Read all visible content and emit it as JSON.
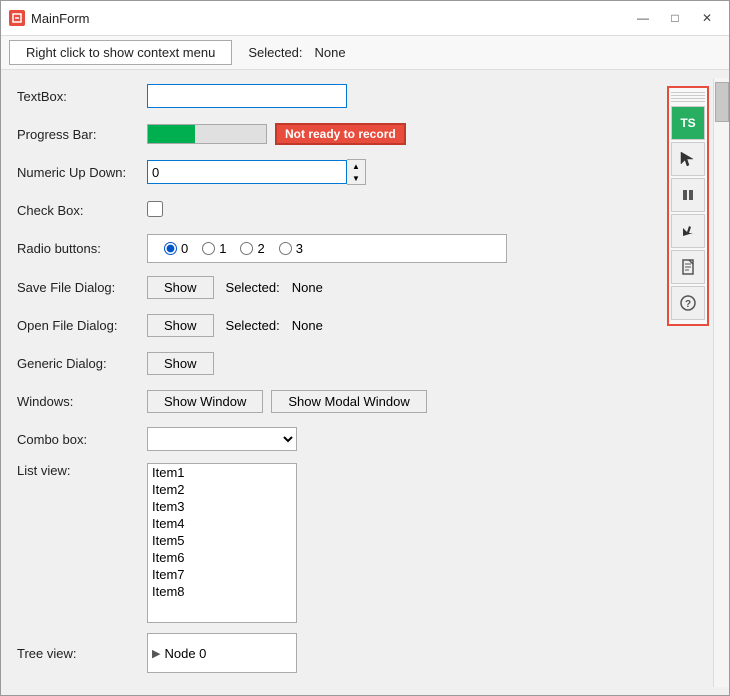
{
  "window": {
    "title": "MainForm",
    "icon": "D"
  },
  "titlebar": {
    "minimize_label": "—",
    "maximize_label": "□",
    "close_label": "✕"
  },
  "toolbar": {
    "context_menu_btn": "Right click to show context menu",
    "selected_label": "Selected:",
    "selected_value": "None"
  },
  "form": {
    "textbox_label": "TextBox:",
    "textbox_value": "",
    "textbox_placeholder": "",
    "progressbar_label": "Progress Bar:",
    "progressbar_fill_pct": 40,
    "progressbar_not_ready": "Not ready to record",
    "numeric_label": "Numeric Up Down:",
    "numeric_value": "0",
    "checkbox_label": "Check Box:",
    "radiobuttons_label": "Radio buttons:",
    "radio_options": [
      "0",
      "1",
      "2",
      "3"
    ],
    "radio_selected": 0,
    "save_file_label": "Save File Dialog:",
    "save_file_btn": "Show",
    "save_file_selected_label": "Selected:",
    "save_file_selected_value": "None",
    "open_file_label": "Open File Dialog:",
    "open_file_btn": "Show",
    "open_file_selected_label": "Selected:",
    "open_file_selected_value": "None",
    "generic_dialog_label": "Generic Dialog:",
    "generic_dialog_btn": "Show",
    "windows_label": "Windows:",
    "show_window_btn": "Show Window",
    "show_modal_btn": "Show Modal Window",
    "combo_label": "Combo box:",
    "list_label": "List view:",
    "list_items": [
      "Item1",
      "Item2",
      "Item3",
      "Item4",
      "Item5",
      "Item6",
      "Item7",
      "Item8"
    ],
    "tree_label": "Tree view:",
    "tree_node": "Node 0"
  },
  "side_panel": {
    "btn_ts_label": "TS",
    "btn_cursor_label": "↖",
    "btn_pause_label": "⏸",
    "btn_arrow_label": "↙",
    "btn_doc_label": "📋",
    "btn_help_label": "?"
  }
}
